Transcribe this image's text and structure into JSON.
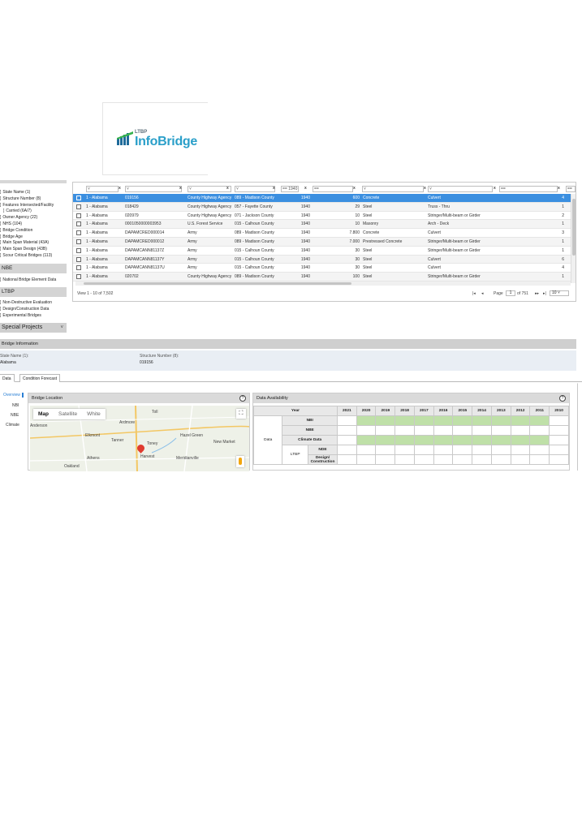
{
  "logo": {
    "small": "LTBP",
    "big": "InfoBridge"
  },
  "left_panel": {
    "items_top": [
      "State Name (1)",
      "Structure Number (8)",
      "Features Intersected/Facility",
      "Carried (6A/7)",
      "Owner Agency (22)",
      "NHS (104)",
      "Bridge Condition",
      "Bridge Age",
      "Main Span Material (43A)",
      "Main Span Design (43B)",
      "Scour Critical Bridges (113)"
    ],
    "nbe_header": "NBE",
    "nbe_items": [
      "National Bridge Element Data"
    ],
    "ltbp_header": "LTBP",
    "ltbp_items": [
      "Non-Destructive Evaluation",
      "Design/Construction Data",
      "Experimental Bridges"
    ],
    "special_header": "Special Projects",
    "special_chevron": "˅"
  },
  "grid": {
    "filter_year": "== 1940",
    "filter_eq": "==",
    "rows": [
      {
        "state": "1 - Alabama",
        "number": "019156",
        "owner": "County Highway Agency",
        "county": "089 - Madison County",
        "year": "1940",
        "length": "600",
        "material": "Concrete",
        "design": "Culvert",
        "spans": "4"
      },
      {
        "state": "1 - Alabama",
        "number": "018429",
        "owner": "County Highway Agency",
        "county": "057 - Fayette County",
        "year": "1940",
        "length": "29",
        "material": "Steel",
        "design": "Truss - Thru",
        "spans": "1"
      },
      {
        "state": "1 - Alabama",
        "number": "020979",
        "owner": "County Highway Agency",
        "county": "071 - Jackson County",
        "year": "1940",
        "length": "10",
        "material": "Steel",
        "design": "Stringer/Multi-beam or Girder",
        "spans": "2"
      },
      {
        "state": "1 - Alabama",
        "number": "0001050000003953",
        "owner": "U.S. Forest Service",
        "county": "015 - Calhoun County",
        "year": "1940",
        "length": "10",
        "material": "Masonry",
        "design": "Arch - Deck",
        "spans": "1"
      },
      {
        "state": "1 - Alabama",
        "number": "DAPAMCRED000014",
        "owner": "Army",
        "county": "089 - Madison County",
        "year": "1940",
        "length": "7.800",
        "material": "Concrete",
        "design": "Culvert",
        "spans": "3"
      },
      {
        "state": "1 - Alabama",
        "number": "DAPAMCRED000012",
        "owner": "Army",
        "county": "089 - Madison County",
        "year": "1940",
        "length": "7.000",
        "material": "Prestressed Concrete",
        "design": "Stringer/Multi-beam or Girder",
        "spans": "1"
      },
      {
        "state": "1 - Alabama",
        "number": "DAPAMCANN81137Z",
        "owner": "Army",
        "county": "015 - Calhoun County",
        "year": "1940",
        "length": "30",
        "material": "Steel",
        "design": "Stringer/Multi-beam or Girder",
        "spans": "1"
      },
      {
        "state": "1 - Alabama",
        "number": "DAPAMCANN81137Y",
        "owner": "Army",
        "county": "015 - Calhoun County",
        "year": "1940",
        "length": "30",
        "material": "Steel",
        "design": "Culvert",
        "spans": "6"
      },
      {
        "state": "1 - Alabama",
        "number": "DAPAMCANN81137U",
        "owner": "Army",
        "county": "015 - Calhoun County",
        "year": "1940",
        "length": "30",
        "material": "Steel",
        "design": "Culvert",
        "spans": "4"
      },
      {
        "state": "1 - Alabama",
        "number": "020702",
        "owner": "County Highway Agency",
        "county": "089 - Madison County",
        "year": "1940",
        "length": "100",
        "material": "Steel",
        "design": "Stringer/Multi-beam or Girder",
        "spans": "1"
      }
    ],
    "view_text": "View 1 - 10 of 7,502",
    "page_label": "Page",
    "page_value": "1",
    "page_of": "of 751",
    "page_size": "10"
  },
  "bridge_info": {
    "bar": "Bridge Information",
    "state_label": "State Name (1):",
    "state_value": "Alabama",
    "struct_label": "Structure Number (8):",
    "struct_value": "019156"
  },
  "tabs": [
    "Data",
    "Condition Forecast"
  ],
  "side_nav": [
    "Overview",
    "NBI",
    "NBE",
    "Climate"
  ],
  "location": {
    "title": "Bridge Location",
    "help": "?",
    "map_tabs": [
      "Map",
      "Satellite",
      "White"
    ],
    "labels": [
      "Toll",
      "Ardmore",
      "Anderson",
      "Elkmont",
      "Athens",
      "Tanner",
      "Toney",
      "Hazel Green",
      "New Market",
      "Harvest",
      "Meridianville",
      "Oakland"
    ]
  },
  "availability": {
    "title": "Data Availability",
    "help": "?",
    "year_label": "Year",
    "years": [
      "2021",
      "2020",
      "2019",
      "2018",
      "2017",
      "2016",
      "2015",
      "2014",
      "2013",
      "2012",
      "2011",
      "2010"
    ],
    "data_label": "Data",
    "ltbp_label": "LTBP",
    "rows": [
      {
        "label": "NBI",
        "filled": [
          false,
          true,
          true,
          true,
          true,
          true,
          true,
          true,
          true,
          true,
          true,
          false
        ]
      },
      {
        "label": "NBE",
        "filled": [
          false,
          false,
          false,
          false,
          false,
          false,
          false,
          false,
          false,
          false,
          false,
          false
        ]
      },
      {
        "label": "Climate Data",
        "filled": [
          false,
          true,
          true,
          true,
          true,
          true,
          true,
          true,
          true,
          true,
          true,
          false
        ]
      },
      {
        "label": "NDE",
        "filled": [
          false,
          false,
          false,
          false,
          false,
          false,
          false,
          false,
          false,
          false,
          false,
          false
        ]
      },
      {
        "label": "Design/ Construction",
        "filled": [
          false,
          false,
          false,
          false,
          false,
          false,
          false,
          false,
          false,
          false,
          false,
          false
        ]
      }
    ]
  },
  "colors": {
    "selected_row": "#3b8fe0",
    "available": "#bfe0a8",
    "accent": "#2a7fd4"
  }
}
